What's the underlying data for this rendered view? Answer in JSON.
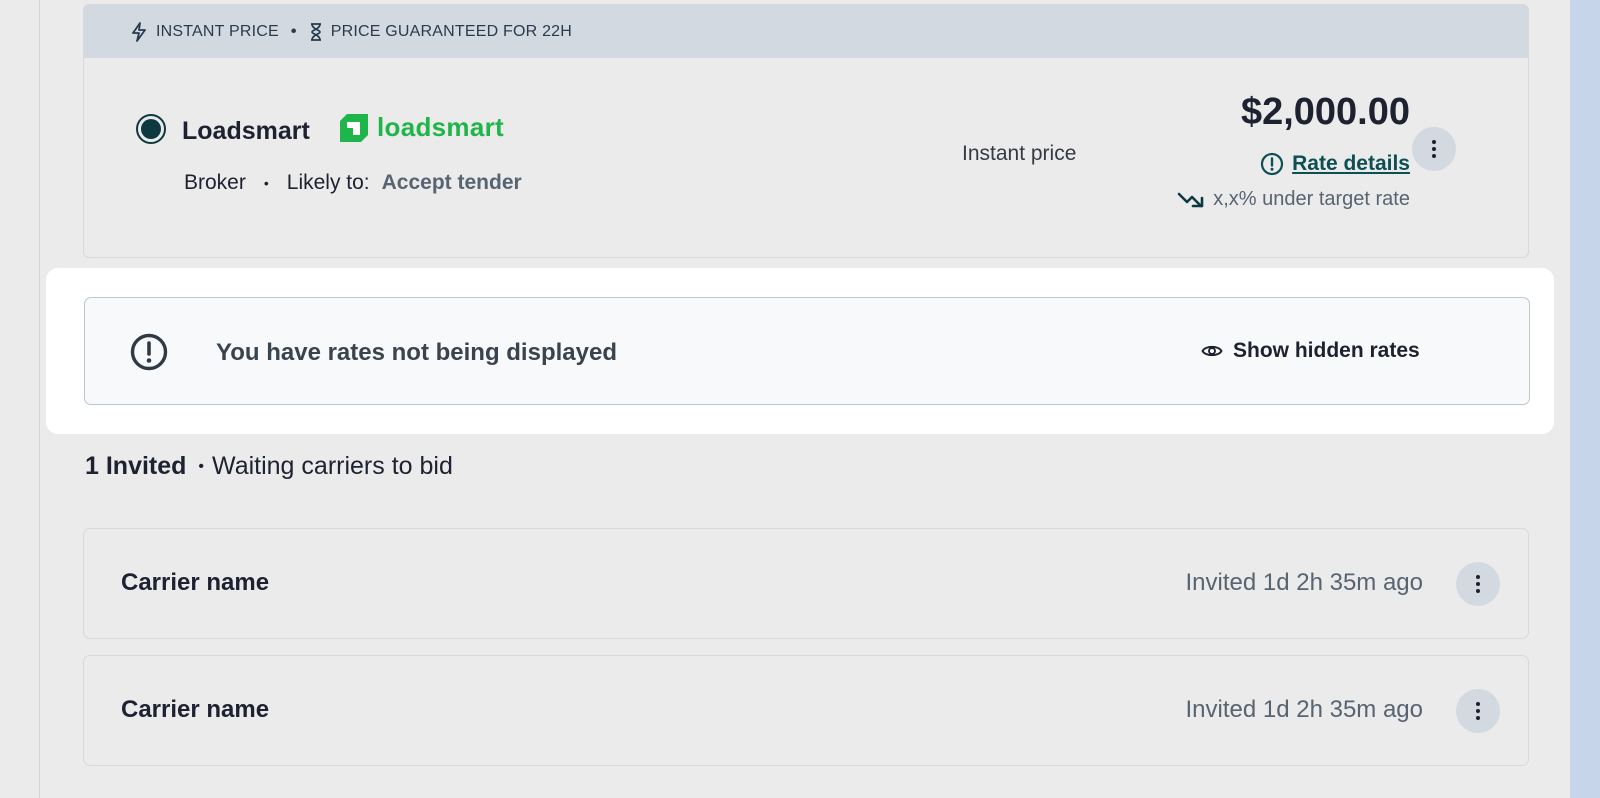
{
  "banner": {
    "instant_price": "INSTANT PRICE",
    "separator": "•",
    "guarantee": "PRICE GUARANTEED FOR 22H",
    "icons": [
      "bolt-icon",
      "hourglass-icon"
    ]
  },
  "quote": {
    "carrier_name": "Loadsmart",
    "logo_text": "loadsmart",
    "type": "Broker",
    "likely_label": "Likely to:",
    "likely_value": "Accept tender",
    "meta_separator": "•",
    "instant_label": "Instant price",
    "price": "$2,000.00",
    "rate_details": "Rate details",
    "under_target": "x,x% under target rate",
    "selected": true
  },
  "notice": {
    "message": "You have rates not being displayed",
    "action": "Show hidden rates"
  },
  "invited": {
    "count_label": "1 Invited",
    "separator": "•",
    "status": "Waiting carriers to bid",
    "rows": [
      {
        "name": "Carrier name",
        "invited": "Invited 1d 2h 35m ago"
      },
      {
        "name": "Carrier name",
        "invited": "Invited 1d 2h 35m ago"
      }
    ]
  },
  "colors": {
    "accent_green": "#1fb54a",
    "teal_dark": "#0d4f52",
    "banner_bg": "#d3d9e0"
  }
}
